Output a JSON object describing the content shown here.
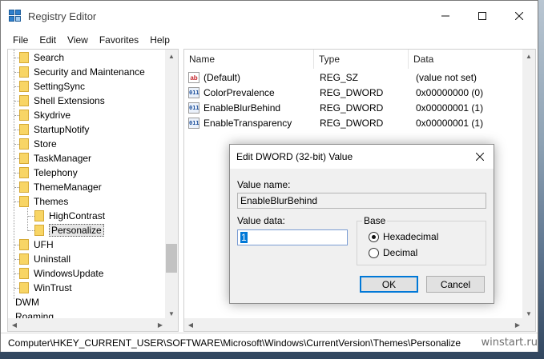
{
  "window": {
    "title": "Registry Editor"
  },
  "menu": [
    "File",
    "Edit",
    "View",
    "Favorites",
    "Help"
  ],
  "tree": {
    "items": [
      {
        "label": "Search",
        "level": 1
      },
      {
        "label": "Security and Maintenance",
        "level": 1
      },
      {
        "label": "SettingSync",
        "level": 1
      },
      {
        "label": "Shell Extensions",
        "level": 1
      },
      {
        "label": "Skydrive",
        "level": 1
      },
      {
        "label": "StartupNotify",
        "level": 1
      },
      {
        "label": "Store",
        "level": 1
      },
      {
        "label": "TaskManager",
        "level": 1
      },
      {
        "label": "Telephony",
        "level": 1
      },
      {
        "label": "ThemeManager",
        "level": 1
      },
      {
        "label": "Themes",
        "level": 1
      },
      {
        "label": "HighContrast",
        "level": 2
      },
      {
        "label": "Personalize",
        "level": 2,
        "selected": true
      },
      {
        "label": "UFH",
        "level": 1
      },
      {
        "label": "Uninstall",
        "level": 1
      },
      {
        "label": "WindowsUpdate",
        "level": 1
      },
      {
        "label": "WinTrust",
        "level": 1
      },
      {
        "label": "DWM",
        "level": 0
      },
      {
        "label": "Roaming",
        "level": 0
      }
    ]
  },
  "list": {
    "columns": [
      "Name",
      "Type",
      "Data"
    ],
    "rows": [
      {
        "name": "(Default)",
        "type": "REG_SZ",
        "data": "(value not set)",
        "icon": "string-value-icon"
      },
      {
        "name": "ColorPrevalence",
        "type": "REG_DWORD",
        "data": "0x00000000 (0)",
        "icon": "dword-value-icon"
      },
      {
        "name": "EnableBlurBehind",
        "type": "REG_DWORD",
        "data": "0x00000001 (1)",
        "icon": "dword-value-icon"
      },
      {
        "name": "EnableTransparency",
        "type": "REG_DWORD",
        "data": "0x00000001 (1)",
        "icon": "dword-value-icon"
      }
    ]
  },
  "status": {
    "path": "Computer\\HKEY_CURRENT_USER\\SOFTWARE\\Microsoft\\Windows\\CurrentVersion\\Themes\\Personalize"
  },
  "dialog": {
    "title": "Edit DWORD (32-bit) Value",
    "value_name_label": "Value name:",
    "value_name": "EnableBlurBehind",
    "value_data_label": "Value data:",
    "value_data": "1",
    "base_label": "Base",
    "base_options": [
      {
        "label": "Hexadecimal",
        "selected": true
      },
      {
        "label": "Decimal",
        "selected": false
      }
    ],
    "ok_label": "OK",
    "cancel_label": "Cancel"
  },
  "watermark": "winstart.ru",
  "colors": {
    "folder": "#f8d565",
    "accent": "#0078d7",
    "selection": "#e6e6e6"
  }
}
